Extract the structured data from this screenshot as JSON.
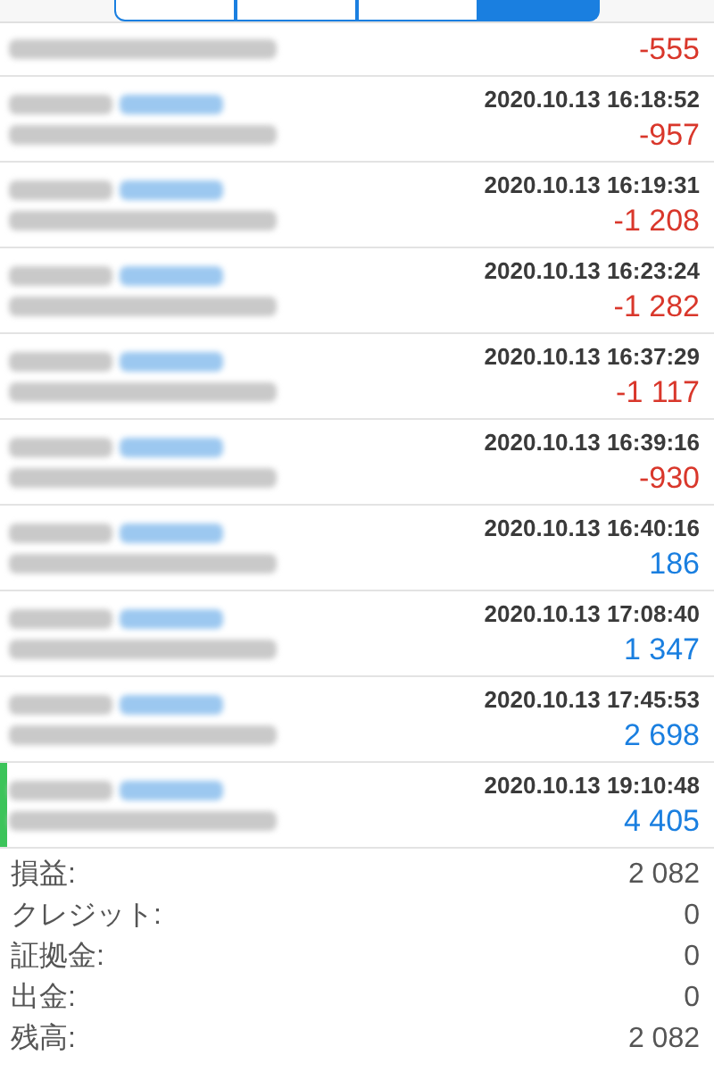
{
  "tabs": [
    {
      "selected": false
    },
    {
      "selected": false
    },
    {
      "selected": false
    },
    {
      "selected": true
    }
  ],
  "trades": [
    {
      "profit": "-555",
      "kind": "loss",
      "highlighted": false
    },
    {
      "time": "2020.10.13 16:18:52",
      "profit": "-957",
      "kind": "loss",
      "highlighted": false
    },
    {
      "time": "2020.10.13 16:19:31",
      "profit": "-1 208",
      "kind": "loss",
      "highlighted": false
    },
    {
      "time": "2020.10.13 16:23:24",
      "profit": "-1 282",
      "kind": "loss",
      "highlighted": false
    },
    {
      "time": "2020.10.13 16:37:29",
      "profit": "-1 117",
      "kind": "loss",
      "highlighted": false
    },
    {
      "time": "2020.10.13 16:39:16",
      "profit": "-930",
      "kind": "loss",
      "highlighted": false
    },
    {
      "time": "2020.10.13 16:40:16",
      "profit": "186",
      "kind": "profit",
      "highlighted": false
    },
    {
      "time": "2020.10.13 17:08:40",
      "profit": "1 347",
      "kind": "profit",
      "highlighted": false
    },
    {
      "time": "2020.10.13 17:45:53",
      "profit": "2 698",
      "kind": "profit",
      "highlighted": false
    },
    {
      "time": "2020.10.13 19:10:48",
      "profit": "4 405",
      "kind": "profit",
      "highlighted": true
    }
  ],
  "summary": [
    {
      "label": "損益:",
      "value": "2 082"
    },
    {
      "label": "クレジット:",
      "value": "0"
    },
    {
      "label": "証拠金:",
      "value": "0"
    },
    {
      "label": "出金:",
      "value": "0"
    },
    {
      "label": "残高:",
      "value": "2 082"
    }
  ]
}
